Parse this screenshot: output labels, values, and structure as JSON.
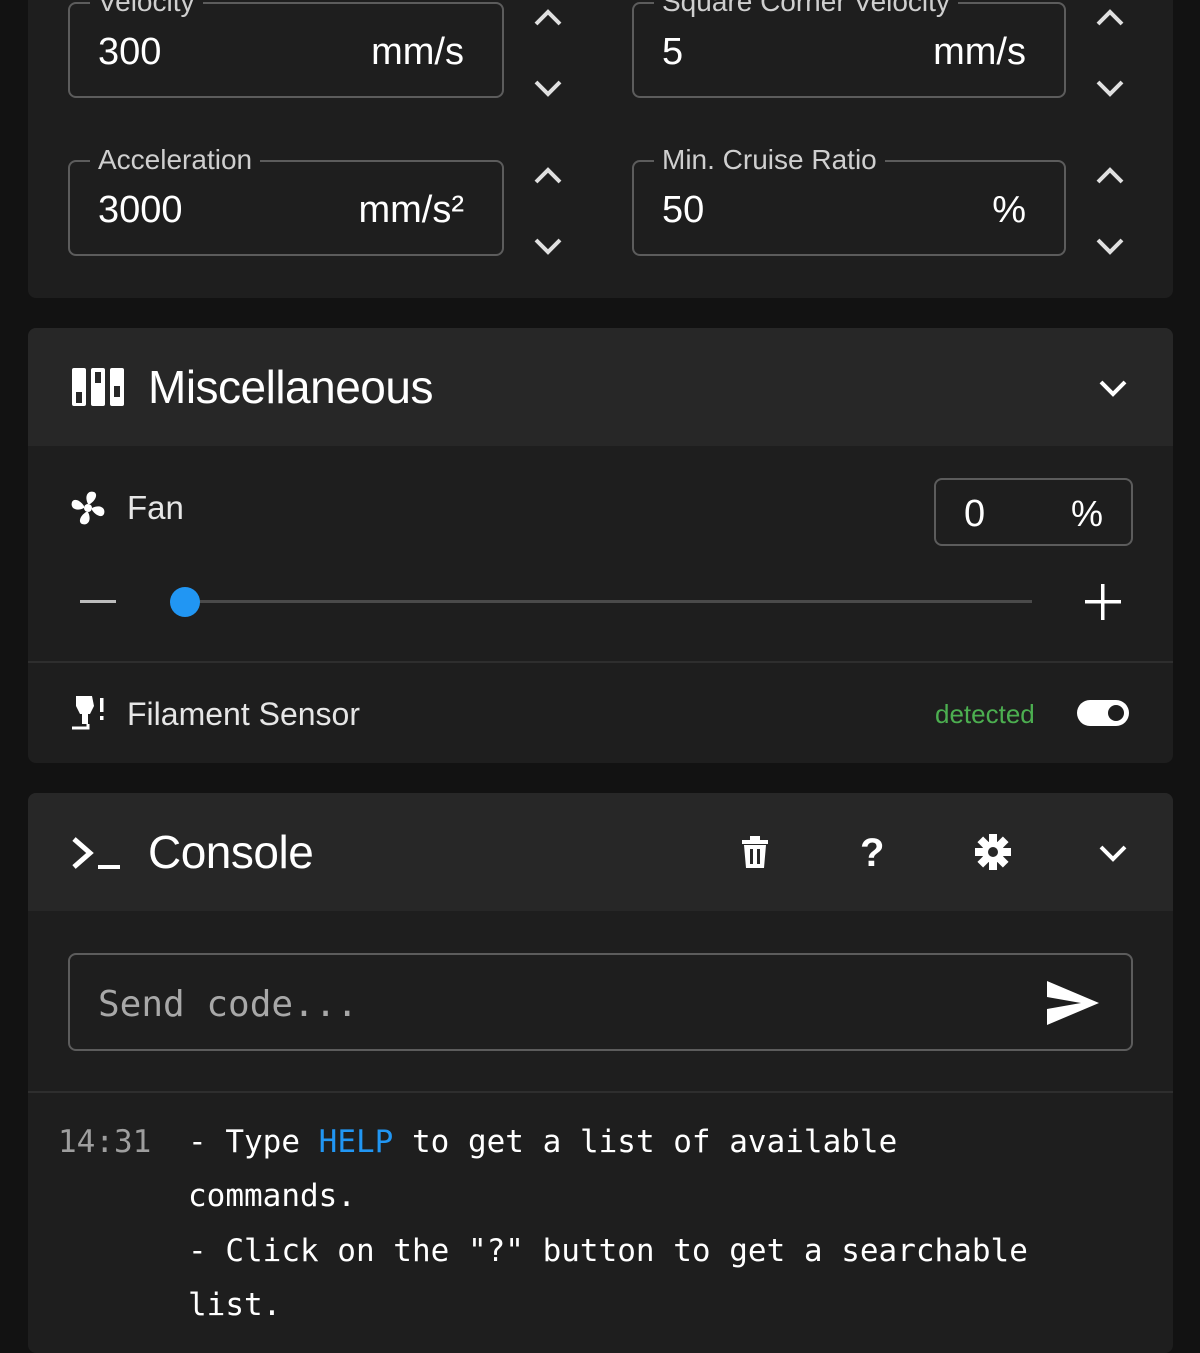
{
  "motion": {
    "fields": [
      {
        "label": "Velocity",
        "value": "300",
        "unit": "mm/s"
      },
      {
        "label": "Square Corner Velocity",
        "value": "5",
        "unit": "mm/s"
      },
      {
        "label": "Acceleration",
        "value": "3000",
        "unit": "mm/s²"
      },
      {
        "label": "Min. Cruise Ratio",
        "value": "50",
        "unit": "%"
      }
    ]
  },
  "miscellaneous": {
    "title": "Miscellaneous",
    "fan": {
      "label": "Fan",
      "value": "0",
      "unit": "%",
      "level": 0
    },
    "filament_sensor": {
      "label": "Filament Sensor",
      "status": "detected",
      "enabled": true
    }
  },
  "console": {
    "title": "Console",
    "input_placeholder": "Send code...",
    "entries": [
      {
        "time": "14:31",
        "line1_prefix": "- Type ",
        "line1_keyword": "HELP",
        "line1_suffix": " to get a list of available",
        "line2": "commands.",
        "line3": "- Click on the \"?\" button to get a searchable",
        "line4": "list."
      }
    ]
  },
  "colors": {
    "accent": "#2196f3",
    "status_ok": "#4caf50",
    "keyword": "#2196f3"
  }
}
